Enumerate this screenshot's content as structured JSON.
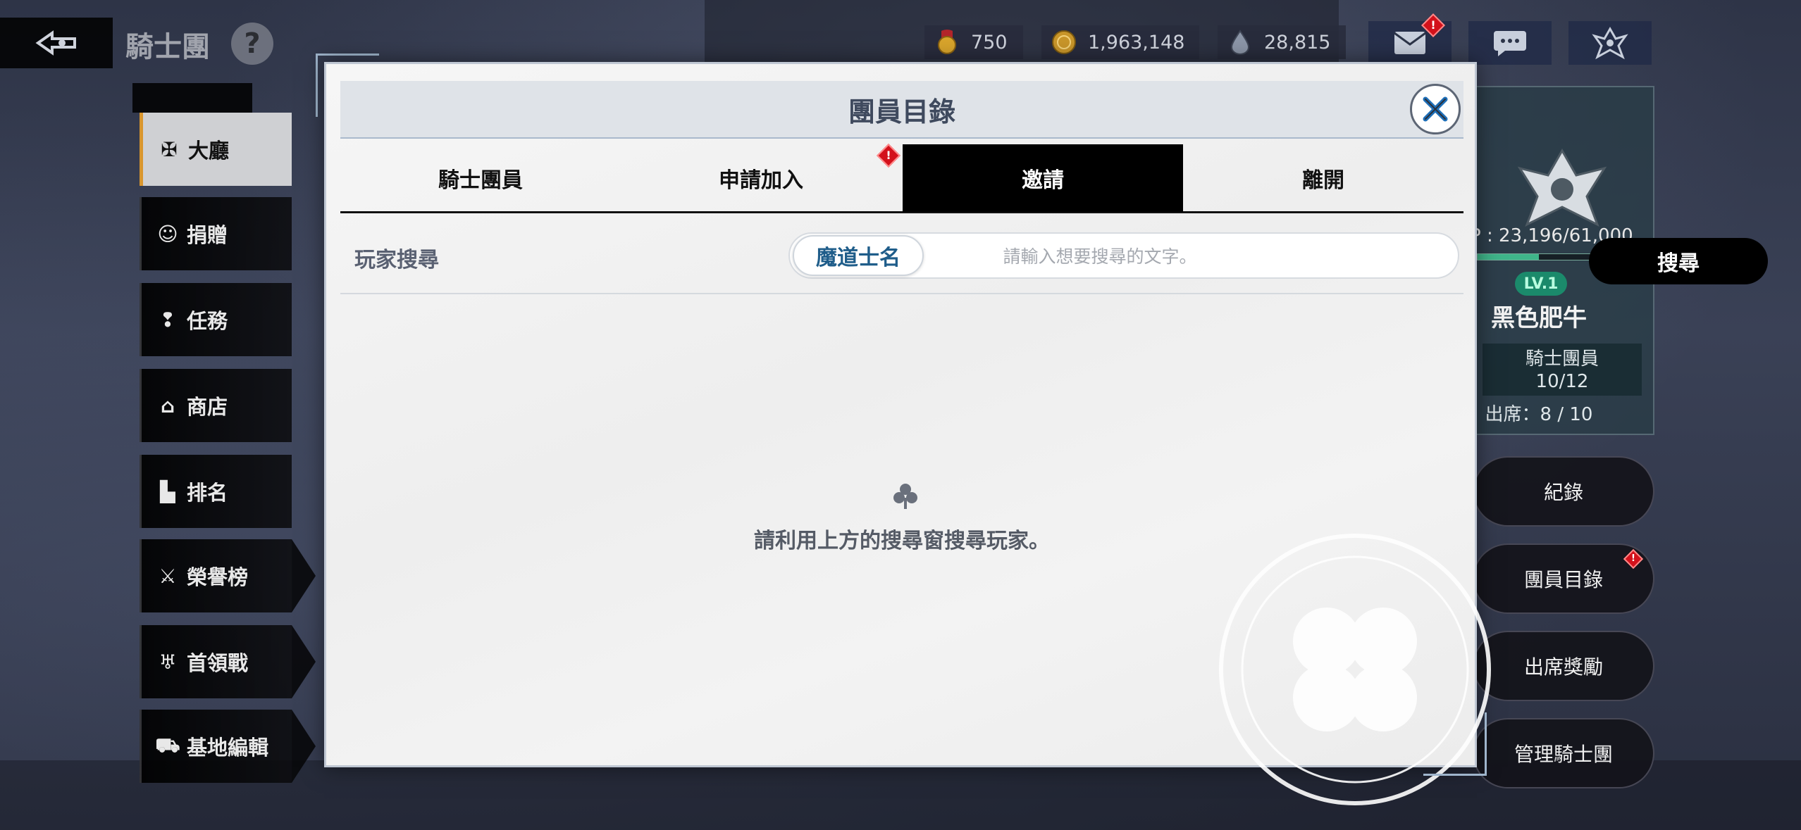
{
  "top_left": {
    "title": "騎士團",
    "help": "?"
  },
  "sidebar": {
    "items": [
      {
        "label": "大廳",
        "icon": "crest-icon",
        "active": true
      },
      {
        "label": "捐贈",
        "icon": "donate-icon",
        "active": false
      },
      {
        "label": "任務",
        "icon": "quest-icon",
        "active": false
      },
      {
        "label": "商店",
        "icon": "shop-icon",
        "active": false
      },
      {
        "label": "排名",
        "icon": "ranking-icon",
        "active": false
      },
      {
        "label": "榮譽榜",
        "icon": "swords-icon",
        "active": false
      },
      {
        "label": "首領戰",
        "icon": "boss-icon",
        "active": false
      },
      {
        "label": "基地編輯",
        "icon": "base-edit-icon",
        "active": false
      }
    ]
  },
  "currency": {
    "medal": "750",
    "gold": "1,963,148",
    "mana": "28,815"
  },
  "top_icons": {
    "mail_badge": "!"
  },
  "guild_info": {
    "exp": "P : 23,196/61,000",
    "exp_progress": 0.38,
    "level": "LV.1",
    "name": "黑色肥牛",
    "member_label": "騎士團員",
    "member_count": "10/12",
    "attendance": "出席：8 / 10"
  },
  "right_buttons": [
    "紀錄",
    "團員目錄",
    "出席獎勵",
    "管理騎士團"
  ],
  "modal": {
    "title": "團員目錄",
    "tabs": [
      "騎士團員",
      "申請加入",
      "邀請",
      "離開"
    ],
    "active_tab": 2,
    "tab_badge": "!",
    "search_label": "玩家搜尋",
    "search_type": "魔道士名",
    "search_placeholder": "請輸入想要搜尋的文字。",
    "search_button": "搜尋",
    "empty_message": "請利用上方的搜尋窗搜尋玩家。"
  },
  "colors": {
    "active_tab_bg": "#000000",
    "badge_red": "#d3111b",
    "level_green": "#1b8a6b",
    "accent_orange": "#d9962e"
  }
}
